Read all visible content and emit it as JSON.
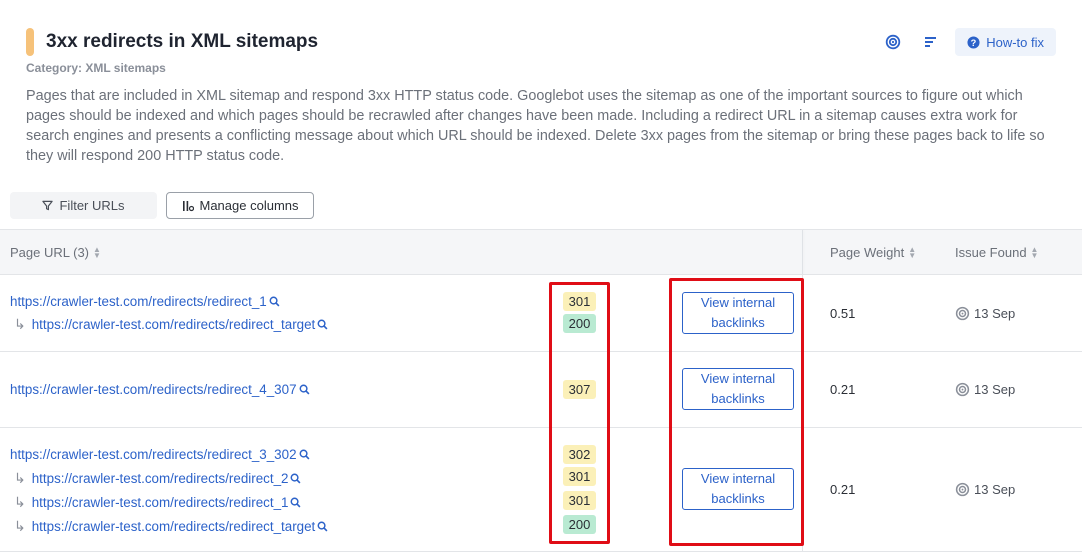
{
  "header": {
    "title": "3xx redirects in XML sitemaps",
    "category": "Category: XML sitemaps",
    "description": "Pages that are included in XML sitemap and respond 3xx HTTP status code. Googlebot uses the sitemap as one of the important sources to figure out which pages should be indexed and which pages should be recrawled after changes have been made. Including a redirect URL in a sitemap causes extra work for search engines and presents a conflicting message about which URL should be indexed. Delete 3xx pages from the sitemap or bring these pages back to life so they will respond 200 HTTP status code.",
    "howto_label": "How-to fix"
  },
  "toolbar": {
    "filter_label": "Filter URLs",
    "columns_label": "Manage columns"
  },
  "table": {
    "columns": {
      "url": "Page URL (3)",
      "weight": "Page Weight",
      "issue": "Issue Found"
    },
    "rows": [
      {
        "urls": [
          "https://crawler-test.com/redirects/redirect_1",
          "https://crawler-test.com/redirects/redirect_target"
        ],
        "codes": [
          "301",
          "200"
        ],
        "backlinks_label": "View internal backlinks",
        "weight": "0.51",
        "issue_date": "13 Sep"
      },
      {
        "urls": [
          "https://crawler-test.com/redirects/redirect_4_307"
        ],
        "codes": [
          "307"
        ],
        "backlinks_label": "View internal backlinks",
        "weight": "0.21",
        "issue_date": "13 Sep"
      },
      {
        "urls": [
          "https://crawler-test.com/redirects/redirect_3_302",
          "https://crawler-test.com/redirects/redirect_2",
          "https://crawler-test.com/redirects/redirect_1",
          "https://crawler-test.com/redirects/redirect_target"
        ],
        "codes": [
          "302",
          "301",
          "301",
          "200"
        ],
        "backlinks_label": "View internal backlinks",
        "weight": "0.21",
        "issue_date": "13 Sep"
      }
    ]
  },
  "colors": {
    "accent": "#f6c27a",
    "link": "#2c62c9",
    "status_3xx": "#fbf0b8",
    "status_200": "#b9ead2",
    "highlight": "#e00d16"
  },
  "icons": {
    "crawl": "crawl-icon",
    "sort": "sort-icon",
    "help": "help-icon",
    "filter": "filter-icon",
    "columns": "columns-icon",
    "search": "search-icon",
    "redirect": "redirect-arrow-icon"
  }
}
